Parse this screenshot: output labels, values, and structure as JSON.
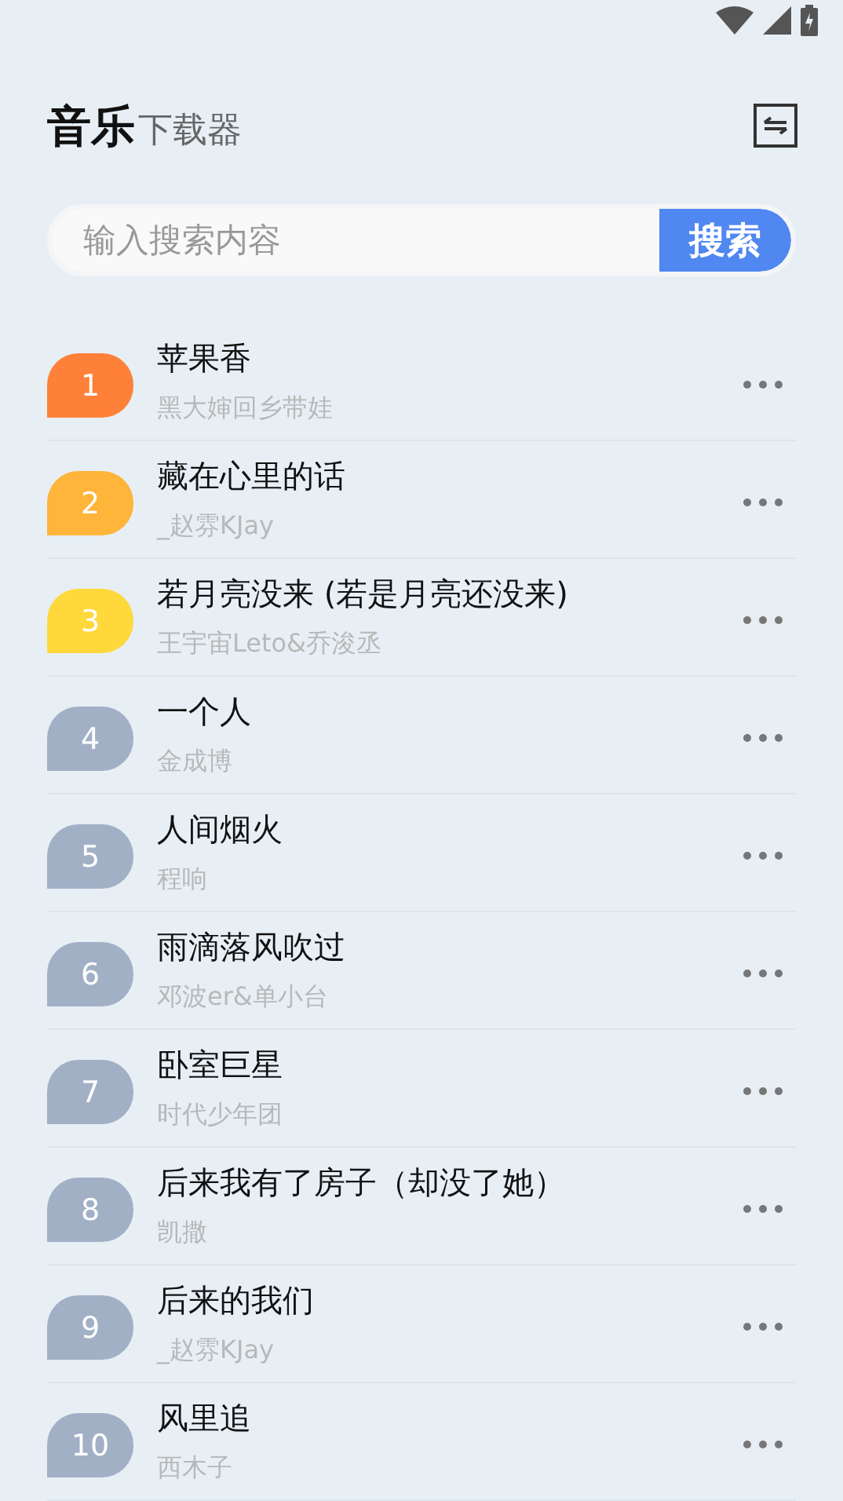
{
  "header": {
    "title": "音乐",
    "subtitle": "下载器"
  },
  "search": {
    "placeholder": "输入搜索内容",
    "button": "搜索"
  },
  "songs": [
    {
      "rank": "1",
      "title": "苹果香",
      "artist": "黑大婶回乡带娃",
      "color": "#ff8038"
    },
    {
      "rank": "2",
      "title": "藏在心里的话",
      "artist": "_赵雰KJay",
      "color": "#ffb43a"
    },
    {
      "rank": "3",
      "title": "若月亮没来 (若是月亮还没来)",
      "artist": "王宇宙Leto&乔浚丞",
      "color": "#ffd83c"
    },
    {
      "rank": "4",
      "title": "一个人",
      "artist": "金成博",
      "color": "#a2b0c6"
    },
    {
      "rank": "5",
      "title": "人间烟火",
      "artist": "程响",
      "color": "#a2b0c6"
    },
    {
      "rank": "6",
      "title": "雨滴落风吹过",
      "artist": "邓波er&单小台",
      "color": "#a2b0c6"
    },
    {
      "rank": "7",
      "title": "卧室巨星",
      "artist": "时代少年团",
      "color": "#a2b0c6"
    },
    {
      "rank": "8",
      "title": "后来我有了房子（却没了她）",
      "artist": "凯撒",
      "color": "#a2b0c6"
    },
    {
      "rank": "9",
      "title": "后来的我们",
      "artist": "_赵雰KJay",
      "color": "#a2b0c6"
    },
    {
      "rank": "10",
      "title": "风里追",
      "artist": "西木子",
      "color": "#a2b0c6"
    }
  ]
}
